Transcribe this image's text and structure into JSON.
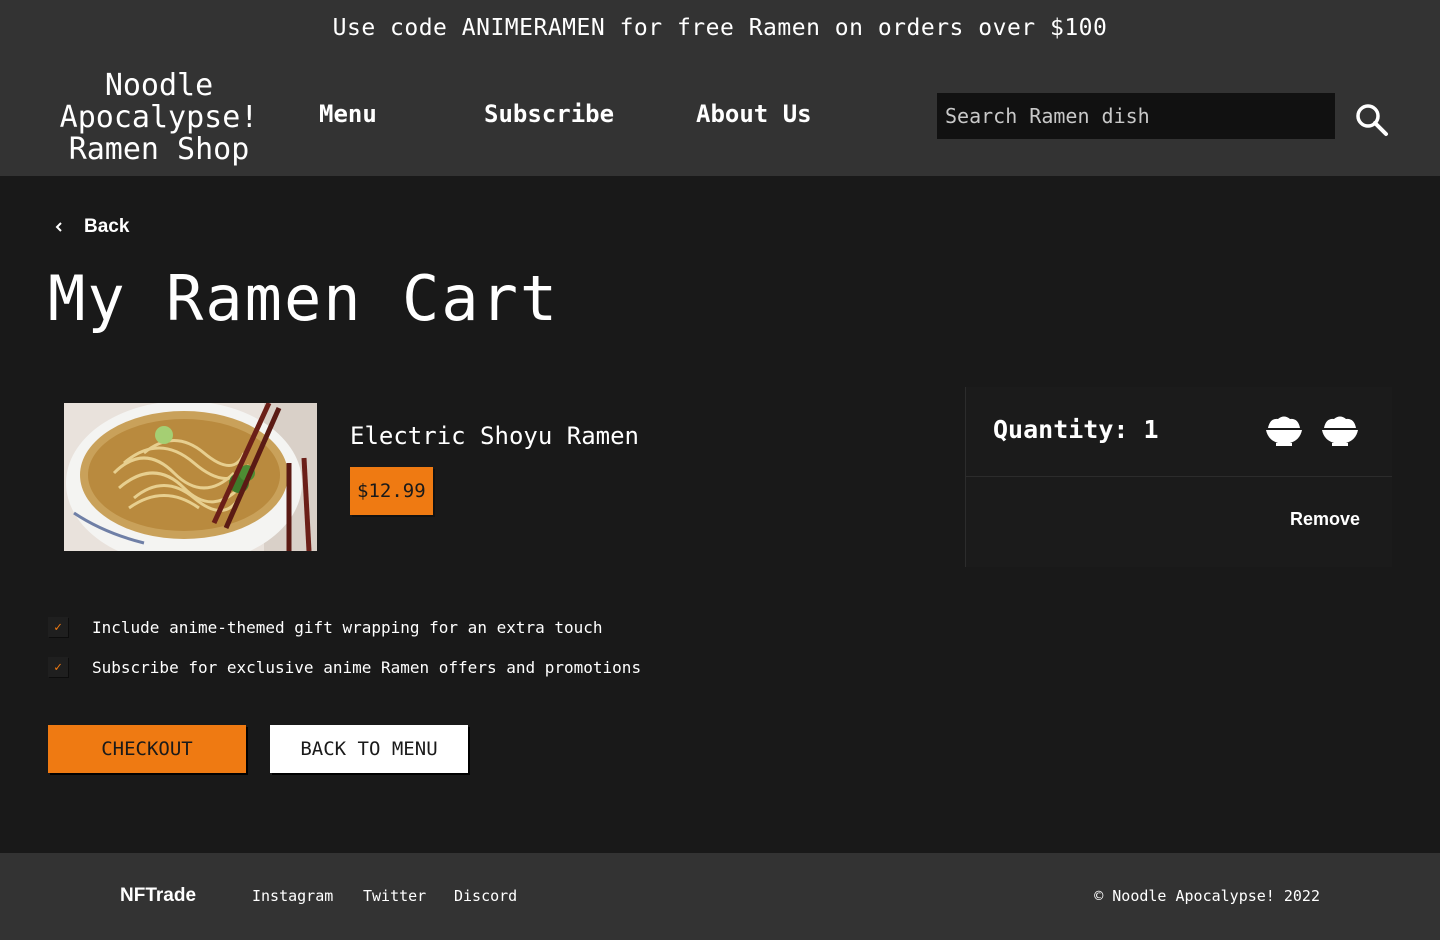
{
  "promo": {
    "text": "Use code ANIMERAMEN for free Ramen on orders over $100"
  },
  "header": {
    "brand_line1": "Noodle",
    "brand_line2": "Apocalypse!",
    "brand_line3": "Ramen Shop",
    "nav": {
      "menu": "Menu",
      "subscribe": "Subscribe",
      "about": "About Us"
    },
    "search": {
      "placeholder": "Search Ramen dish",
      "value": "",
      "icon": "search-icon"
    }
  },
  "main": {
    "back_label": "Back",
    "title": "My Ramen Cart",
    "item": {
      "name": "Electric Shoyu Ramen",
      "price": "$12.99",
      "image": "ramen-bowl-image"
    },
    "quantity_label": "Quantity: 1",
    "quantity_value": 1,
    "remove_label": "Remove",
    "options": [
      {
        "label": "Include anime-themed gift wrapping for an extra touch",
        "checked": true
      },
      {
        "label": "Subscribe for exclusive anime Ramen offers and promotions",
        "checked": true
      }
    ],
    "checkout_label": "CHECKOUT",
    "back_to_menu_label": "BACK TO MENU"
  },
  "footer": {
    "brand": "NFTrade",
    "links": [
      "Instagram",
      "Twitter",
      "Discord"
    ],
    "copyright": "© Noodle Apocalypse! 2022"
  },
  "colors": {
    "accent": "#ef7a12",
    "bg": "#191919",
    "bar": "#333333"
  }
}
